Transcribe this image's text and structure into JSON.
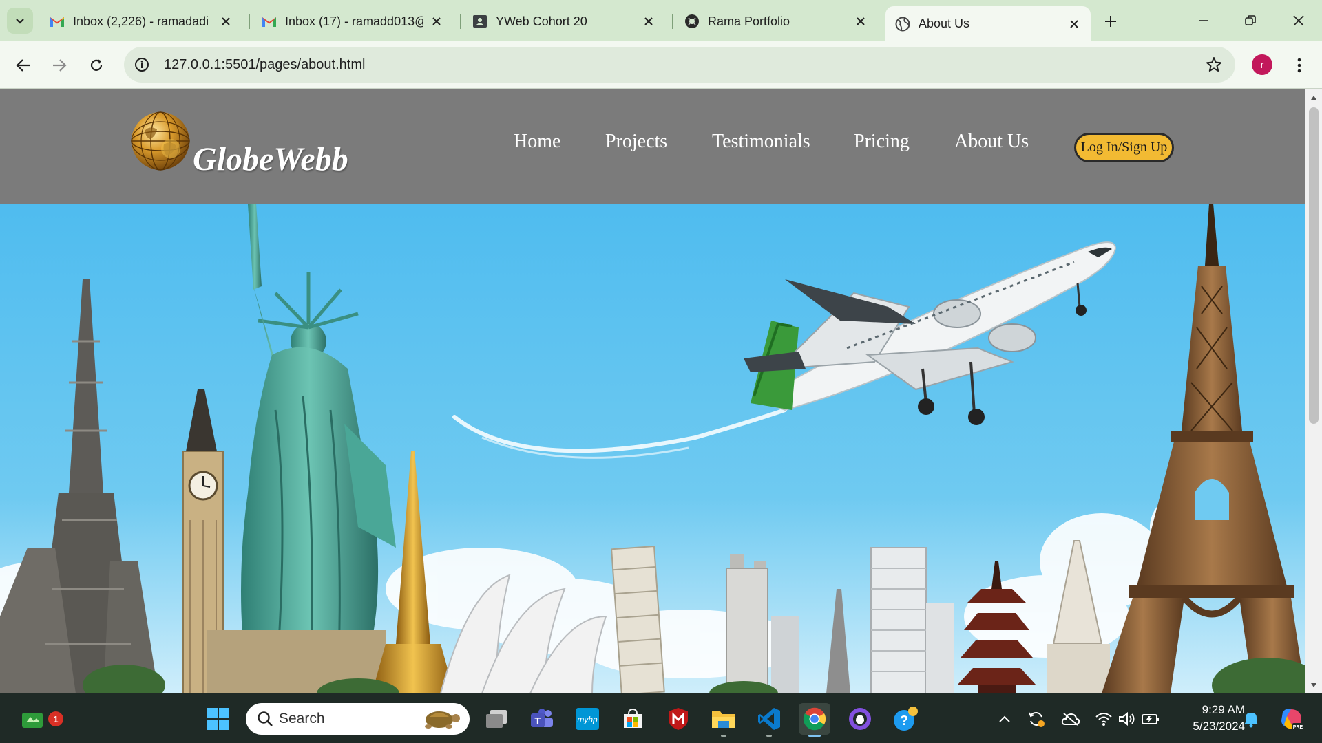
{
  "browser": {
    "tabs": [
      {
        "title": "Inbox (2,226) - ramadadi",
        "icon": "gmail-icon"
      },
      {
        "title": "Inbox (17) - ramadd013@",
        "icon": "gmail-icon"
      },
      {
        "title": "YWeb Cohort 20",
        "icon": "classroom-icon"
      },
      {
        "title": "Rama Portfolio",
        "icon": "portfolio-icon"
      },
      {
        "title": "About Us",
        "icon": "globe-icon"
      }
    ],
    "active_tab": 4,
    "url": "127.0.0.1:5501/pages/about.html",
    "profile_initial": "r"
  },
  "site": {
    "logo_text": "GlobeWebb",
    "nav": [
      "Home",
      "Projects",
      "Testimonials",
      "Pricing",
      "About Us"
    ],
    "login_label": "Log In/Sign Up",
    "colors": {
      "header_bg": "#7b7b7b",
      "button_bg": "#f2ba33",
      "sky": "#5ec1ee"
    }
  },
  "taskbar": {
    "search_placeholder": "Search",
    "notification_count": "1",
    "time": "9:29 AM",
    "date": "5/23/2024",
    "apps": [
      "start-icon",
      "task-view-icon",
      "teams-icon",
      "myhp-icon",
      "store-icon",
      "mcafee-icon",
      "file-explorer-icon",
      "vscode-icon",
      "chrome-icon",
      "github-desktop-icon",
      "help-icon"
    ]
  }
}
